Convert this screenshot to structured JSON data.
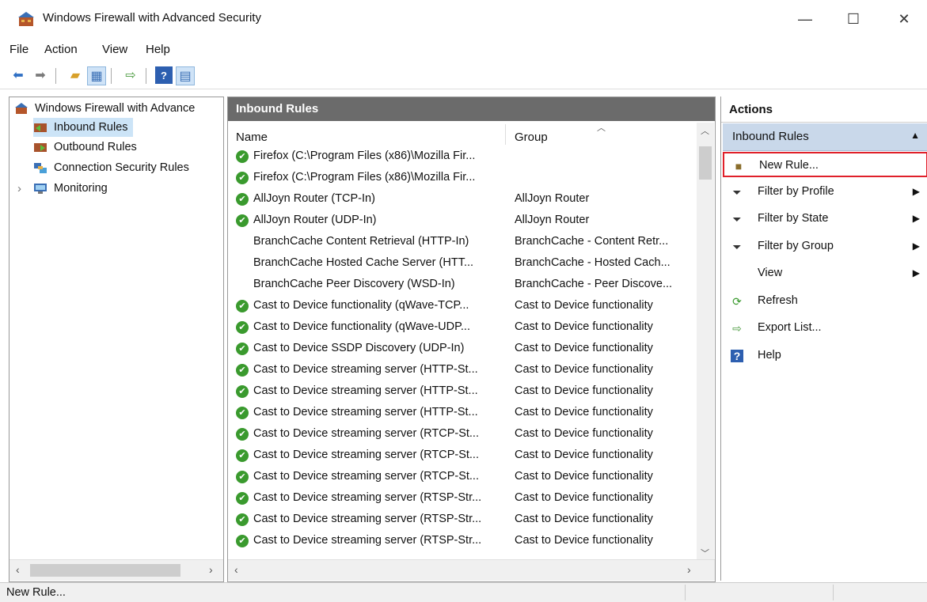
{
  "window": {
    "title": "Windows Firewall with Advanced Security",
    "minimize": "—",
    "maximize": "☐",
    "close": "✕"
  },
  "menu": {
    "items": [
      {
        "label": "File"
      },
      {
        "label": "Action"
      },
      {
        "label": "View"
      },
      {
        "label": "Help"
      }
    ]
  },
  "tree": {
    "root": "Windows Firewall with Advance",
    "items": [
      {
        "label": "Inbound Rules",
        "selected": true
      },
      {
        "label": "Outbound Rules"
      },
      {
        "label": "Connection Security Rules"
      },
      {
        "label": "Monitoring",
        "expander": "›"
      }
    ]
  },
  "rules": {
    "header": "Inbound Rules",
    "columns": {
      "name": "Name",
      "group": "Group"
    },
    "rows": [
      {
        "name": "Firefox (C:\\Program Files (x86)\\Mozilla Fir...",
        "group": "",
        "enabled": true
      },
      {
        "name": "Firefox (C:\\Program Files (x86)\\Mozilla Fir...",
        "group": "",
        "enabled": true
      },
      {
        "name": "AllJoyn Router (TCP-In)",
        "group": "AllJoyn Router",
        "enabled": true
      },
      {
        "name": "AllJoyn Router (UDP-In)",
        "group": "AllJoyn Router",
        "enabled": true
      },
      {
        "name": "BranchCache Content Retrieval (HTTP-In)",
        "group": "BranchCache - Content Retr...",
        "enabled": false
      },
      {
        "name": "BranchCache Hosted Cache Server (HTT...",
        "group": "BranchCache - Hosted Cach...",
        "enabled": false
      },
      {
        "name": "BranchCache Peer Discovery (WSD-In)",
        "group": "BranchCache - Peer Discove...",
        "enabled": false
      },
      {
        "name": "Cast to Device functionality (qWave-TCP...",
        "group": "Cast to Device functionality",
        "enabled": true
      },
      {
        "name": "Cast to Device functionality (qWave-UDP...",
        "group": "Cast to Device functionality",
        "enabled": true
      },
      {
        "name": "Cast to Device SSDP Discovery (UDP-In)",
        "group": "Cast to Device functionality",
        "enabled": true
      },
      {
        "name": "Cast to Device streaming server (HTTP-St...",
        "group": "Cast to Device functionality",
        "enabled": true
      },
      {
        "name": "Cast to Device streaming server (HTTP-St...",
        "group": "Cast to Device functionality",
        "enabled": true
      },
      {
        "name": "Cast to Device streaming server (HTTP-St...",
        "group": "Cast to Device functionality",
        "enabled": true
      },
      {
        "name": "Cast to Device streaming server (RTCP-St...",
        "group": "Cast to Device functionality",
        "enabled": true
      },
      {
        "name": "Cast to Device streaming server (RTCP-St...",
        "group": "Cast to Device functionality",
        "enabled": true
      },
      {
        "name": "Cast to Device streaming server (RTCP-St...",
        "group": "Cast to Device functionality",
        "enabled": true
      },
      {
        "name": "Cast to Device streaming server (RTSP-Str...",
        "group": "Cast to Device functionality",
        "enabled": true
      },
      {
        "name": "Cast to Device streaming server (RTSP-Str...",
        "group": "Cast to Device functionality",
        "enabled": true
      },
      {
        "name": "Cast to Device streaming server (RTSP-Str...",
        "group": "Cast to Device functionality",
        "enabled": true
      }
    ]
  },
  "actions": {
    "title": "Actions",
    "section": "Inbound Rules",
    "items": [
      {
        "label": "New Rule...",
        "icon": "new-rule-icon",
        "highlighted": true
      },
      {
        "label": "Filter by Profile",
        "icon": "filter-icon",
        "submenu": true
      },
      {
        "label": "Filter by State",
        "icon": "filter-icon",
        "submenu": true
      },
      {
        "label": "Filter by Group",
        "icon": "filter-icon",
        "submenu": true
      },
      {
        "label": "View",
        "icon": "",
        "submenu": true
      },
      {
        "label": "Refresh",
        "icon": "refresh-icon"
      },
      {
        "label": "Export List...",
        "icon": "export-icon"
      },
      {
        "label": "Help",
        "icon": "help-icon"
      }
    ]
  },
  "status": {
    "text": "New Rule..."
  },
  "colors": {
    "highlight_border": "#e0202a",
    "section_bg": "#c9d8ea",
    "header_bg": "#6b6b6b",
    "enabled_check": "#3a9a2e"
  }
}
